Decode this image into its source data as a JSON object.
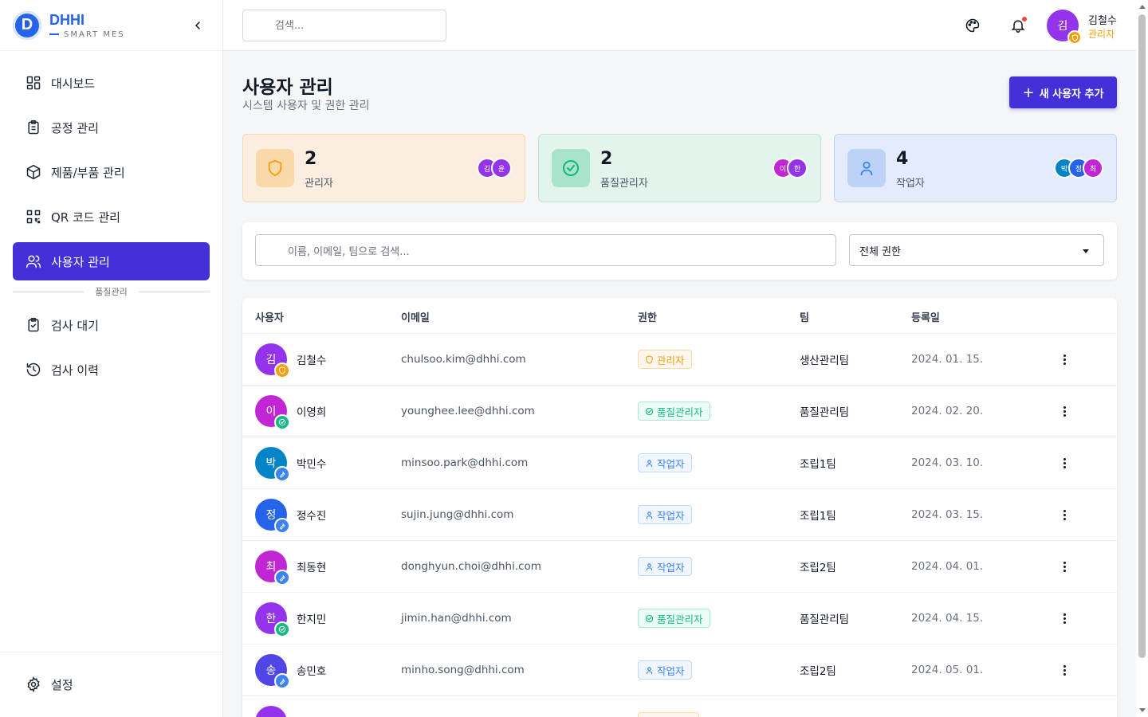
{
  "brand": {
    "logo_letter": "D",
    "name": "DHHI",
    "subtitle": "SMART MES"
  },
  "sidebar": {
    "items": [
      {
        "label": "대시보드",
        "icon": "dashboard-icon"
      },
      {
        "label": "공정 관리",
        "icon": "clipboard-icon"
      },
      {
        "label": "제품/부품 관리",
        "icon": "package-icon"
      },
      {
        "label": "QR 코드 관리",
        "icon": "qr-code-icon"
      },
      {
        "label": "사용자 관리",
        "icon": "users-icon",
        "active": true
      }
    ],
    "section_label": "품질관리",
    "quality_items": [
      {
        "label": "검사 대기",
        "icon": "clipboard-check-icon"
      },
      {
        "label": "검사 이력",
        "icon": "history-icon"
      }
    ],
    "settings_label": "설정"
  },
  "header": {
    "search_placeholder": "검색...",
    "user": {
      "initial": "김",
      "name": "김철수",
      "role": "관리자"
    }
  },
  "page": {
    "title": "사용자 관리",
    "subtitle": "시스템 사용자 및 권한 관리",
    "add_button": "새 사용자 추가"
  },
  "stats": [
    {
      "count": "2",
      "label": "관리자",
      "avatars": [
        "김",
        "윤"
      ]
    },
    {
      "count": "2",
      "label": "품질관리자",
      "avatars": [
        "이",
        "한"
      ]
    },
    {
      "count": "4",
      "label": "작업자",
      "avatars": [
        "박",
        "정",
        "최"
      ]
    }
  ],
  "filters": {
    "search_placeholder": "이름, 이메일, 팀으로 검색...",
    "role_select": "전체 권한"
  },
  "table": {
    "columns": [
      "사용자",
      "이메일",
      "권한",
      "팀",
      "등록일"
    ],
    "rows": [
      {
        "initial": "김",
        "name": "김철수",
        "email": "chulsoo.kim@dhhi.com",
        "role": "관리자",
        "team": "생산관리팀",
        "date": "2024. 01. 15."
      },
      {
        "initial": "이",
        "name": "이영희",
        "email": "younghee.lee@dhhi.com",
        "role": "품질관리자",
        "team": "품질관리팀",
        "date": "2024. 02. 20."
      },
      {
        "initial": "박",
        "name": "박민수",
        "email": "minsoo.park@dhhi.com",
        "role": "작업자",
        "team": "조립1팀",
        "date": "2024. 03. 10."
      },
      {
        "initial": "정",
        "name": "정수진",
        "email": "sujin.jung@dhhi.com",
        "role": "작업자",
        "team": "조립1팀",
        "date": "2024. 03. 15."
      },
      {
        "initial": "최",
        "name": "최동현",
        "email": "donghyun.choi@dhhi.com",
        "role": "작업자",
        "team": "조립2팀",
        "date": "2024. 04. 01."
      },
      {
        "initial": "한",
        "name": "한지민",
        "email": "jimin.han@dhhi.com",
        "role": "품질관리자",
        "team": "품질관리팀",
        "date": "2024. 04. 15."
      },
      {
        "initial": "송",
        "name": "송민호",
        "email": "minho.song@dhhi.com",
        "role": "작업자",
        "team": "조립2팀",
        "date": "2024. 05. 01."
      }
    ]
  },
  "colors": {
    "primary": "#4430d8",
    "admin": "#f59e0b",
    "quality": "#10b981",
    "worker": "#3b82f6",
    "admin_card_bg": "#fbeee0",
    "quality_card_bg": "#e3f4ec",
    "worker_card_bg": "#e4ecfb"
  }
}
